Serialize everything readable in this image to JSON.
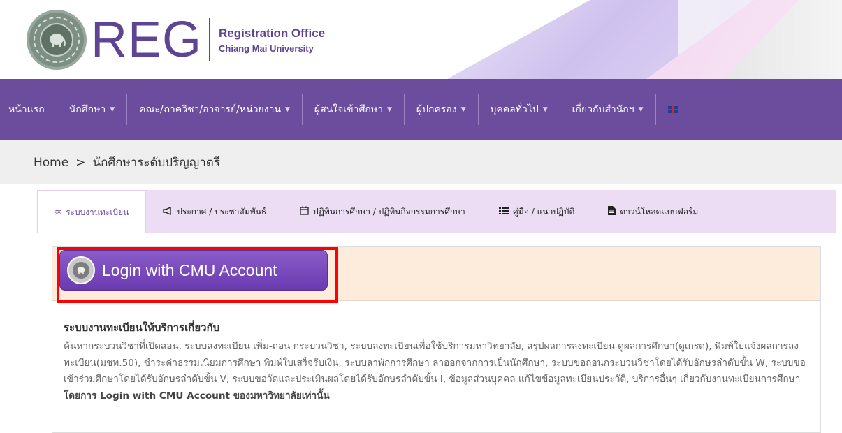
{
  "header": {
    "logo_mark": "REG",
    "logo_title": "Registration Office",
    "logo_subtitle": "Chiang Mai University"
  },
  "nav": {
    "items": [
      {
        "label": "หน้าแรก",
        "has_dropdown": false
      },
      {
        "label": "นักศึกษา",
        "has_dropdown": true
      },
      {
        "label": "คณะ/ภาควิชา/อาจารย์/หน่วยงาน",
        "has_dropdown": true
      },
      {
        "label": "ผู้สนใจเข้าศึกษา",
        "has_dropdown": true
      },
      {
        "label": "ผู้ปกครอง",
        "has_dropdown": true
      },
      {
        "label": "บุคคลทั่วไป",
        "has_dropdown": true
      },
      {
        "label": "เกี่ยวกับสำนักฯ",
        "has_dropdown": true
      }
    ],
    "caret": "▼",
    "language_flag": "uk-flag-icon"
  },
  "breadcrumb": {
    "home": "Home",
    "separator": ">",
    "current": "นักศึกษาระดับปริญญาตรี"
  },
  "tabs": [
    {
      "label": "ระบบงานทะเบียน",
      "icon": "database-icon",
      "glyph": "≋",
      "active": true
    },
    {
      "label": "ประกาศ / ประชาสัมพันธ์",
      "icon": "bullhorn-icon",
      "glyph": "📢",
      "active": false
    },
    {
      "label": "ปฏิทินการศึกษา / ปฏิทินกิจกรรมการศึกษา",
      "icon": "calendar-icon",
      "glyph": "📅",
      "active": false
    },
    {
      "label": "คู่มือ / แนวปฏิบัติ",
      "icon": "list-icon",
      "glyph": "☰",
      "active": false
    },
    {
      "label": "ดาวน์โหลดแบบฟอร์ม",
      "icon": "file-icon",
      "glyph": "🗎",
      "active": false
    }
  ],
  "login": {
    "button_label": "Login with CMU Account"
  },
  "content": {
    "heading": "ระบบงานทะเบียนให้บริการเกี่ยวกับ",
    "body": "ค้นหากระบวนวิชาที่เปิดสอน, ระบบลงทะเบียน เพิ่ม-ถอน กระบวนวิชา, ระบบลงทะเบียนเพื่อใช้บริการมหาวิทยาลัย, สรุปผลการลงทะเบียน ดูผลการศึกษา(ดูเกรด), พิมพ์ใบแจ้งผลการลงทะเบียน(มชท.50), ชำระค่าธรรมเนียมการศึกษา พิมพ์ใบเสร็จรับเงิน, ระบบลาพักการศึกษา ลาออกจากการเป็นนักศึกษา, ระบบขอถอนกระบวนวิชาโดยได้รับอักษรลำดับขั้น W, ระบบขอเข้าร่วมศึกษาโดยได้รับอักษรลำดับขั้น V, ระบบขอวัดและประเมินผลโดยได้รับอักษรลำดับขั้น I, ข้อมูลส่วนบุคคล แก้ไขข้อมูลทะเบียนประวัติ, บริการอื่นๆ เกี่ยวกับงานทะเบียนการศึกษา ",
    "body_bold": "โดยการ Login with CMU Account ของมหาวิทยาลัยเท่านั้น"
  },
  "colors": {
    "primary_purple": "#6c4c9c",
    "tab_bar": "#ecdcf4",
    "login_strip": "#fdebdb",
    "highlight_red": "#ff0000"
  }
}
